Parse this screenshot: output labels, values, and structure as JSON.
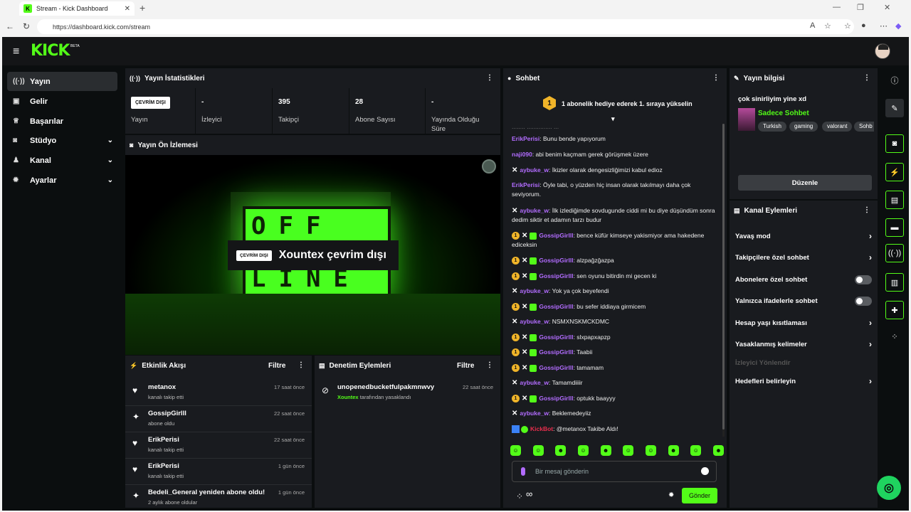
{
  "browser": {
    "tab_title": "Stream - Kick Dashboard",
    "url": "https://dashboard.kick.com/stream"
  },
  "app": {
    "logo": "KICK",
    "logo_badge": "BETA"
  },
  "sidebar": {
    "items": [
      {
        "label": "Yayın",
        "icon": "broadcast-icon"
      },
      {
        "label": "Gelir",
        "icon": "wallet-icon"
      },
      {
        "label": "Başarılar",
        "icon": "trophy-icon"
      },
      {
        "label": "Stüdyo",
        "icon": "camera-icon"
      },
      {
        "label": "Kanal",
        "icon": "users-icon"
      },
      {
        "label": "Ayarlar",
        "icon": "gear-icon"
      }
    ]
  },
  "stats": {
    "title": "Yayın İstatistikleri",
    "status_badge": "ÇEVRİM DIŞI",
    "status_label": "Yayın",
    "viewers_value": "-",
    "viewers_label": "İzleyici",
    "followers_value": "395",
    "followers_label": "Takipçi",
    "subs_value": "28",
    "subs_label": "Abone Sayısı",
    "uptime_value": "-",
    "uptime_label": "Yayında Olduğu Süre"
  },
  "preview": {
    "title": "Yayın Ön İzlemesi",
    "sign_row1": "OFF",
    "sign_row2": "LINE",
    "badge": "ÇEVRİM DIŞI",
    "offline_text": "Xountex çevrim dışı"
  },
  "activity": {
    "title": "Etkinlik Akışı",
    "filter": "Filtre",
    "rows": [
      {
        "name": "metanox",
        "sub": "kanalı takip etti",
        "time": "17 saat önce",
        "icon": "heart-icon"
      },
      {
        "name": "GossipGirlll",
        "sub": "abone oldu",
        "time": "22 saat önce",
        "icon": "sparkle-icon"
      },
      {
        "name": "ErikPerisi",
        "sub": "kanalı takip etti",
        "time": "22 saat önce",
        "icon": "heart-icon"
      },
      {
        "name": "ErikPerisi",
        "sub": "kanalı takip etti",
        "time": "1 gün önce",
        "icon": "heart-icon"
      },
      {
        "name": "Bedeli_General yeniden abone oldu!",
        "sub": "2 aylık abone oldular",
        "time": "1 gün önce",
        "icon": "sparkle-icon"
      }
    ]
  },
  "moderation": {
    "title": "Denetim Eylemleri",
    "filter": "Filtre",
    "row_name": "unopenedbucketfulpakmnwvy",
    "row_by": "Xountex",
    "row_sub": "tarafından yasaklandı",
    "row_time": "22 saat önce"
  },
  "chat": {
    "title": "Sohbet",
    "pinned": "1 abonelik hediye ederek 1. sıraya yükselin",
    "pinned_num": "1",
    "partial_line": "........ ............... ...",
    "messages": [
      {
        "user": "ErikPerisi",
        "text": ": Bunu bende yapıyorum"
      },
      {
        "user": "naji090",
        "text": ": abi benim kaçmam gerek görüşmek üzere"
      },
      {
        "user": "aybuke_w",
        "text": ": İkizler olarak dengesizliğimizi kabul edioz"
      },
      {
        "user": "ErikPerisi",
        "text": ": Öyle tabi, o yüzden hiç insan olarak takılmayı daha çok seviyorum."
      },
      {
        "user": "aybuke_w",
        "text": ": İlk izlediğimde sovdugunde ciddi mi bu diye düşündüm sonra dedim siktir et adamın tarzı budur"
      },
      {
        "user": "GossipGirlll",
        "text": ": bence küfür kimseye yakismiyor ama hakedene ediceksin"
      },
      {
        "user": "GossipGirlll",
        "text": ": alzpağzğazpa"
      },
      {
        "user": "GossipGirlll",
        "text": ": sen oyunu bitirdin mi gecen ki"
      },
      {
        "user": "aybuke_w",
        "text": ": Yok ya çok beyefendi"
      },
      {
        "user": "GossipGirlll",
        "text": ": bu sefer iddiaya girmicem"
      },
      {
        "user": "aybuke_w",
        "text": ": NSMXNSKMCKDMC"
      },
      {
        "user": "GossipGirlll",
        "text": ": slxpapxapzp"
      },
      {
        "user": "GossipGirlll",
        "text": ": Taabii"
      },
      {
        "user": "GossipGirlll",
        "text": ": tamamam"
      },
      {
        "user": "aybuke_w",
        "text": ": Tamamdiiiir"
      },
      {
        "user": "GossipGirlll",
        "text": ": optukk baayyy"
      },
      {
        "user": "aybuke_w",
        "text": ": Beklemedeyiiz"
      },
      {
        "user": "KickBot",
        "text": ": @metanox Takibe Aldı!"
      }
    ],
    "input_placeholder": "Bir mesaj gönderin",
    "send_label": "Gönder",
    "infinity": "∞"
  },
  "stream_info": {
    "title": "Yayın bilgisi",
    "stream_title": "çok sinirliyim yine xd",
    "category": "Sadece Sohbet",
    "tags": [
      "Turkish",
      "gaming",
      "valorant",
      "Sohb"
    ],
    "edit_label": "Düzenle"
  },
  "channel_actions": {
    "title": "Kanal Eylemleri",
    "items": [
      {
        "label": "Yavaş mod",
        "control": "chevron"
      },
      {
        "label": "Takipçilere özel sohbet",
        "control": "chevron"
      },
      {
        "label": "Abonelere özel sohbet",
        "control": "toggle"
      },
      {
        "label": "Yalnızca ifadelerle sohbet",
        "control": "toggle"
      },
      {
        "label": "Hesap yaşı kısıtlaması",
        "control": "chevron"
      },
      {
        "label": "Yasaklanmış kelimeler",
        "control": "chevron"
      },
      {
        "label": "İzleyici Yönlendir",
        "control": "none"
      },
      {
        "label": "Hedefleri belirleyin",
        "control": "chevron"
      }
    ]
  },
  "colors": {
    "accent": "#53fc18",
    "background": "#0b0e0f",
    "panel": "#191b1f",
    "purple_user": "#b26cff",
    "bot_red": "#e92e4d"
  }
}
